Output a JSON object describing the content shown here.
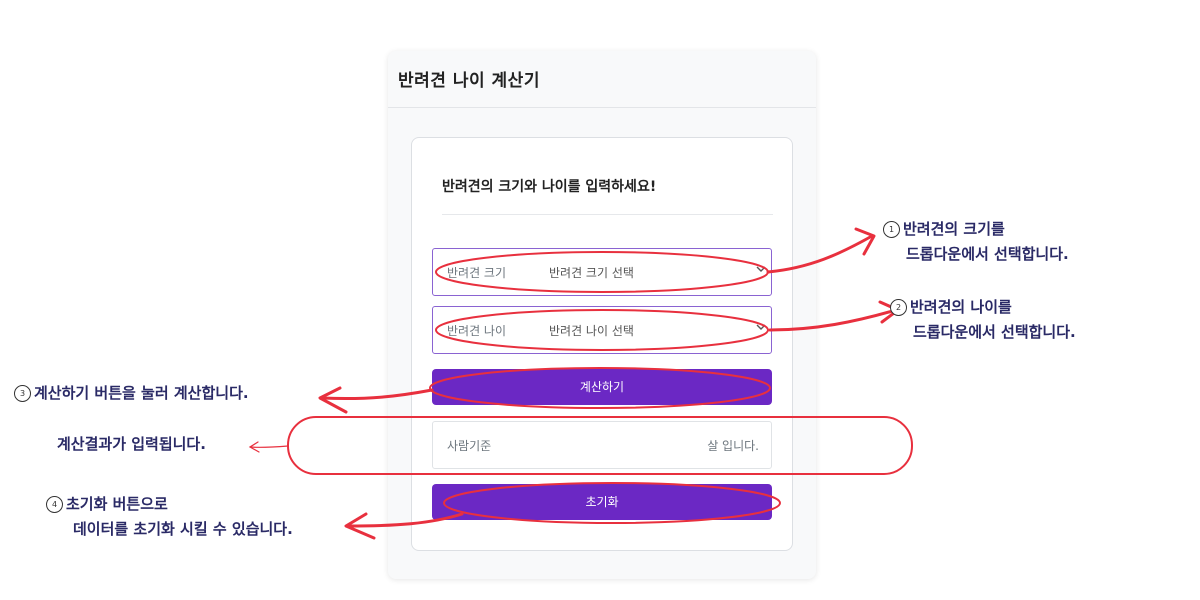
{
  "app": {
    "title": "반려견 나이 계산기",
    "form_heading": "반려견의 크기와 나이를 입력하세요!"
  },
  "size_select": {
    "label": "반려견 크기",
    "selected": "반려견 크기 선택"
  },
  "age_select": {
    "label": "반려견 나이",
    "selected": "반려견 나이 선택"
  },
  "calculate_button": {
    "label": "계산하기"
  },
  "result": {
    "prefix": "사람기준",
    "suffix": "살 입니다."
  },
  "reset_button": {
    "label": "초기화"
  },
  "annotations": {
    "note1": {
      "number": "1",
      "line1": "반려견의 크기를",
      "line2": "드롭다운에서 선택합니다."
    },
    "note2": {
      "number": "2",
      "line1": "반려견의 나이를",
      "line2": "드롭다운에서 선택합니다."
    },
    "note3": {
      "number": "3",
      "line1": "계산하기 버튼을 눌러 계산합니다."
    },
    "note_result": {
      "line1": "계산결과가 입력됩니다."
    },
    "note4": {
      "number": "4",
      "line1": "초기화 버튼으로",
      "line2": "데이터를 초기화 시킬 수 있습니다."
    }
  },
  "colors": {
    "primary_button": "#6b28c4",
    "select_border": "#8a63d2",
    "annotation_red": "#e8303e",
    "annotation_text": "#2a2a66"
  }
}
